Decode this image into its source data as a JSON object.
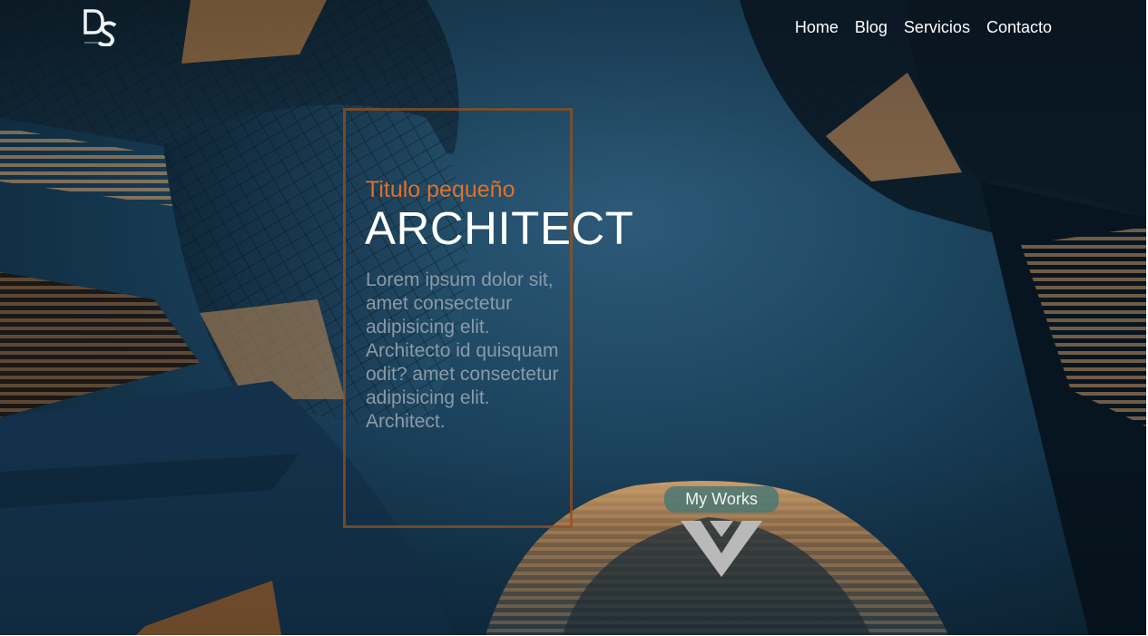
{
  "logo": {
    "text": "DS",
    "icon": "ds-logo-icon"
  },
  "nav": {
    "items": [
      {
        "label": "Home"
      },
      {
        "label": "Blog"
      },
      {
        "label": "Servicios"
      },
      {
        "label": "Contacto"
      }
    ]
  },
  "hero": {
    "subtitle": "Titulo pequeño",
    "title": "ARCHITECT",
    "description": "Lorem ipsum dolor sit, amet consectetur adipisicing elit. Architecto id quisquam odit? amet consectetur adipisicing elit. Architect.",
    "background": "skyscrapers-photo",
    "colors": {
      "accent": "#e0702a",
      "frame": "#96501e",
      "sky": "#1d4560"
    }
  },
  "cta": {
    "label": "My Works",
    "icon": "chevron-down-icon"
  }
}
